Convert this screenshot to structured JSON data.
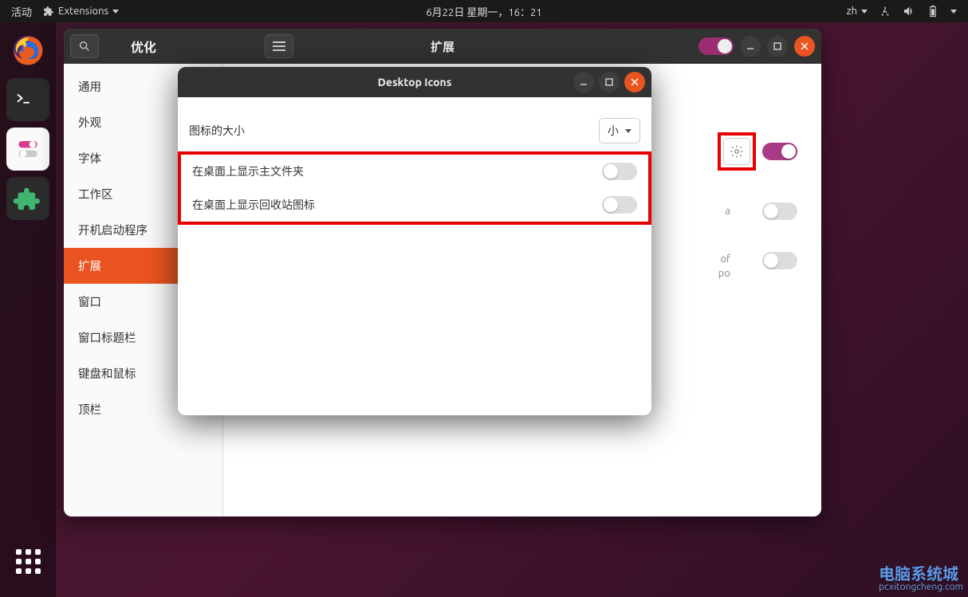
{
  "topbar": {
    "activities": "活动",
    "extensions": "Extensions",
    "datetime": "6月22日 星期一，16：21",
    "lang": "zh"
  },
  "tweaks": {
    "app_title": "优化",
    "page_title": "扩展",
    "sidebar": [
      "通用",
      "外观",
      "字体",
      "工作区",
      "开机启动程序",
      "扩展",
      "窗口",
      "窗口标题栏",
      "键盘和鼠标",
      "顶栏"
    ],
    "rows": {
      "r1_text": "a",
      "r2_text_a": "of",
      "r2_text_b": "po"
    }
  },
  "dialog": {
    "title": "Desktop Icons",
    "icon_size_label": "图标的大小",
    "icon_size_value": "小",
    "show_home_label": "在桌面上显示主文件夹",
    "show_trash_label": "在桌面上显示回收站图标"
  },
  "watermark": {
    "main": "电脑系统城",
    "sub": "pcxitongcheng.com"
  }
}
